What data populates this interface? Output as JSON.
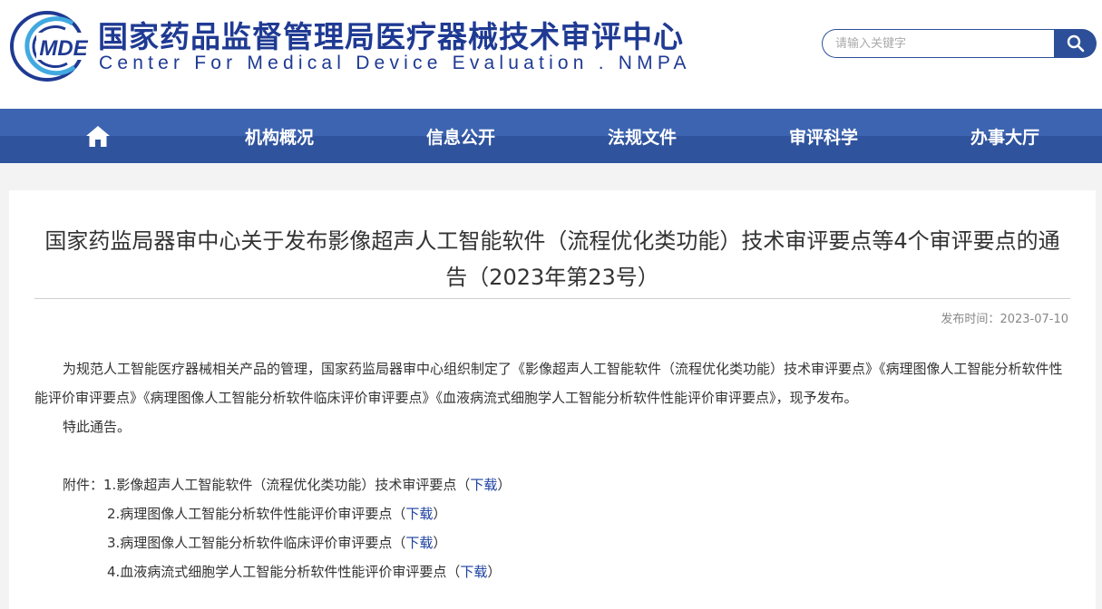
{
  "header": {
    "logo_text": "MDE",
    "title_cn": "国家药品监督管理局医疗器械技术审评中心",
    "title_en": "Center For Medical Device Evaluation . NMPA",
    "search": {
      "placeholder": "请输入关键字",
      "icon": "search-icon"
    }
  },
  "nav": {
    "home_icon": "home-icon",
    "items": [
      "机构概况",
      "信息公开",
      "法规文件",
      "审评科学",
      "办事大厅"
    ]
  },
  "article": {
    "title": "国家药监局器审中心关于发布影像超声人工智能软件（流程优化类功能）技术审评要点等4个审评要点的通告（2023年第23号）",
    "publish_label": "发布时间：",
    "publish_date": "2023-07-10",
    "body": "为规范人工智能医疗器械相关产品的管理，国家药监局器审中心组织制定了《影像超声人工智能软件（流程优化类功能）技术审评要点》《病理图像人工智能分析软件性能评价审评要点》《病理图像人工智能分析软件临床评价审评要点》《血液病流式细胞学人工智能分析软件性能评价审评要点》，现予发布。",
    "notice": "特此通告。",
    "attachments_label": "附件：",
    "attachments": [
      {
        "text": "1.影像超声人工智能软件（流程优化类功能）技术审评要点（",
        "link": "下载",
        "close": "）"
      },
      {
        "text": "2.病理图像人工智能分析软件性能评价审评要点（",
        "link": "下载",
        "close": "）"
      },
      {
        "text": "3.病理图像人工智能分析软件临床评价审评要点（",
        "link": "下载",
        "close": "）"
      },
      {
        "text": "4.血液病流式细胞学人工智能分析软件性能评价审评要点（",
        "link": "下载",
        "close": "）"
      }
    ]
  },
  "colors": {
    "brand_blue": "#1f3a93",
    "nav_blue": "#3d64b0",
    "link_blue": "#1a3fa0"
  }
}
